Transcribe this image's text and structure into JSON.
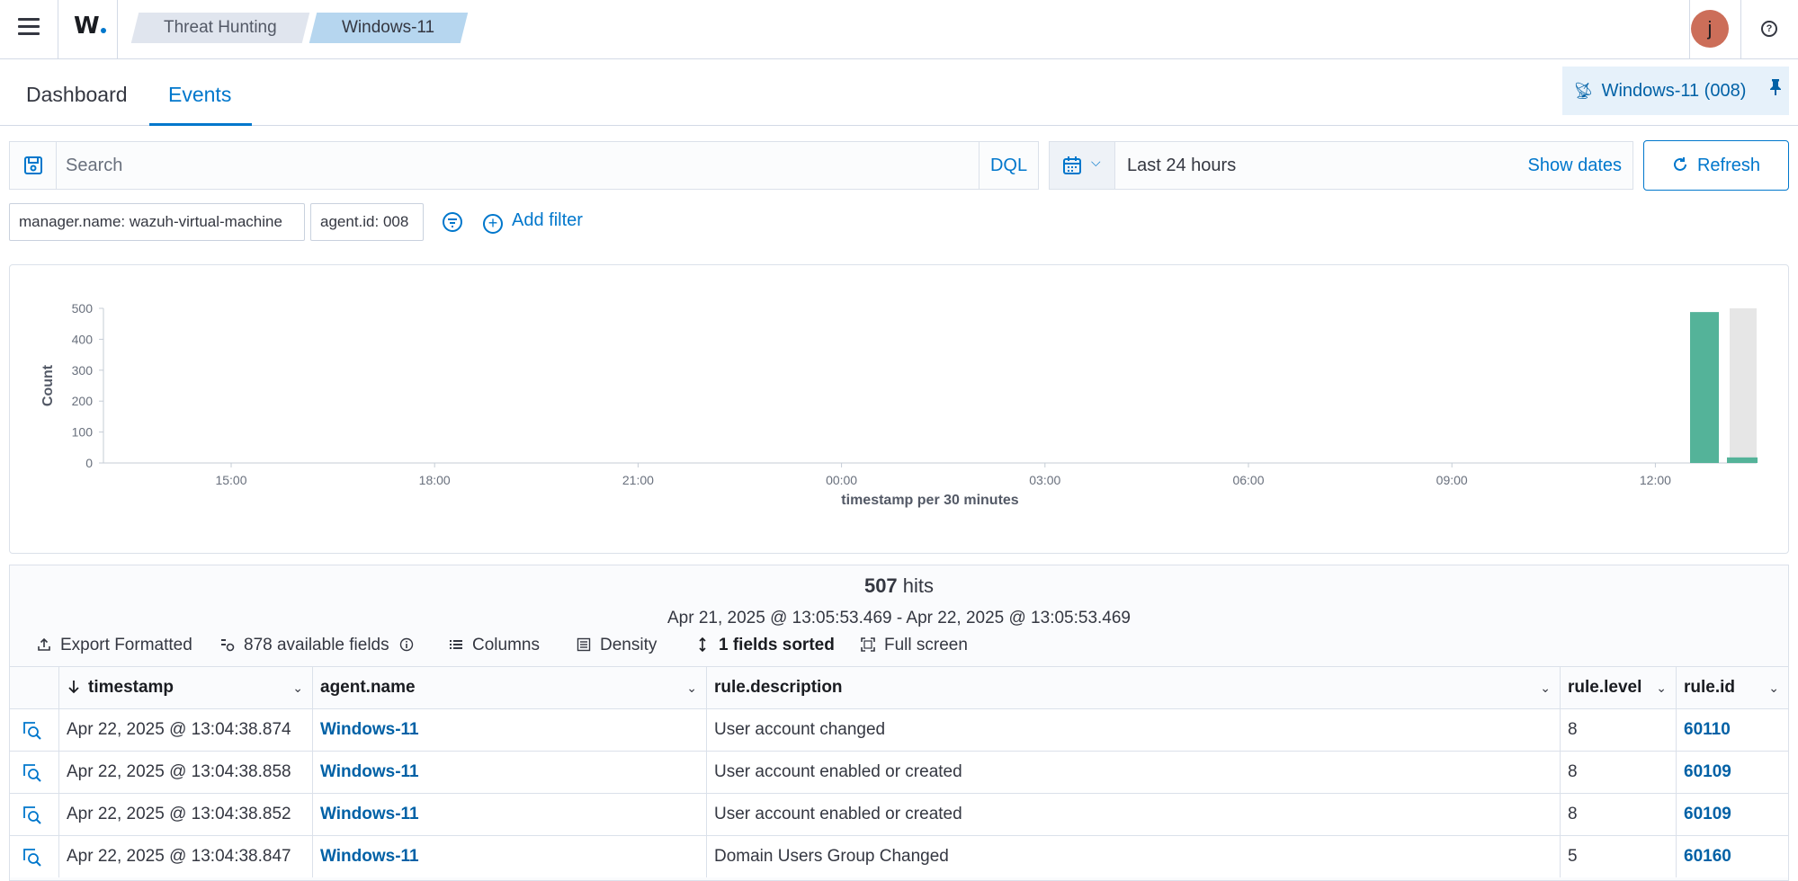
{
  "header": {
    "logo": "W",
    "breadcrumbs": [
      "Threat Hunting",
      "Windows-11"
    ],
    "avatar_initial": "j",
    "help_glyph": "?"
  },
  "tabs": [
    {
      "label": "Dashboard",
      "active": false
    },
    {
      "label": "Events",
      "active": true
    }
  ],
  "agent_pill": {
    "label": "Windows-11 (008)",
    "icon": "broadcast-icon",
    "pin_icon": "pin-icon"
  },
  "search": {
    "placeholder": "Search",
    "language": "DQL"
  },
  "date_picker": {
    "label": "Last 24 hours",
    "show_dates": "Show dates"
  },
  "refresh_label": "Refresh",
  "filters": [
    "manager.name: wazuh-virtual-machine",
    "agent.id: 008"
  ],
  "add_filter_label": "Add filter",
  "chart_data": {
    "type": "bar",
    "ylabel": "Count",
    "xlabel": "timestamp per 30 minutes",
    "ylim": [
      0,
      500
    ],
    "y_ticks": [
      "0",
      "100",
      "200",
      "300",
      "400",
      "500"
    ],
    "x_ticks": [
      "15:00",
      "18:00",
      "21:00",
      "00:00",
      "03:00",
      "06:00",
      "09:00",
      "12:00"
    ],
    "series": [
      {
        "values": [
          488,
          18
        ],
        "color": "#54b399"
      }
    ],
    "highlight_bucket_color": "#e6e6e6",
    "grid": false
  },
  "results": {
    "hits_count": "507",
    "hits_label": "hits",
    "range": "Apr 21, 2025 @ 13:05:53.469 - Apr 22, 2025 @ 13:05:53.469",
    "toolbar": {
      "export": "Export Formatted",
      "fields": "878 available fields",
      "columns": "Columns",
      "density": "Density",
      "sorted": "1 fields sorted",
      "fullscreen": "Full screen"
    },
    "columns": [
      "timestamp",
      "agent.name",
      "rule.description",
      "rule.level",
      "rule.id"
    ],
    "rows": [
      {
        "timestamp": "Apr 22, 2025 @ 13:04:38.874",
        "agent": "Windows-11",
        "description": "User account changed",
        "level": "8",
        "id": "60110"
      },
      {
        "timestamp": "Apr 22, 2025 @ 13:04:38.858",
        "agent": "Windows-11",
        "description": "User account enabled or created",
        "level": "8",
        "id": "60109"
      },
      {
        "timestamp": "Apr 22, 2025 @ 13:04:38.852",
        "agent": "Windows-11",
        "description": "User account enabled or created",
        "level": "8",
        "id": "60109"
      },
      {
        "timestamp": "Apr 22, 2025 @ 13:04:38.847",
        "agent": "Windows-11",
        "description": "Domain Users Group Changed",
        "level": "5",
        "id": "60160"
      }
    ]
  }
}
